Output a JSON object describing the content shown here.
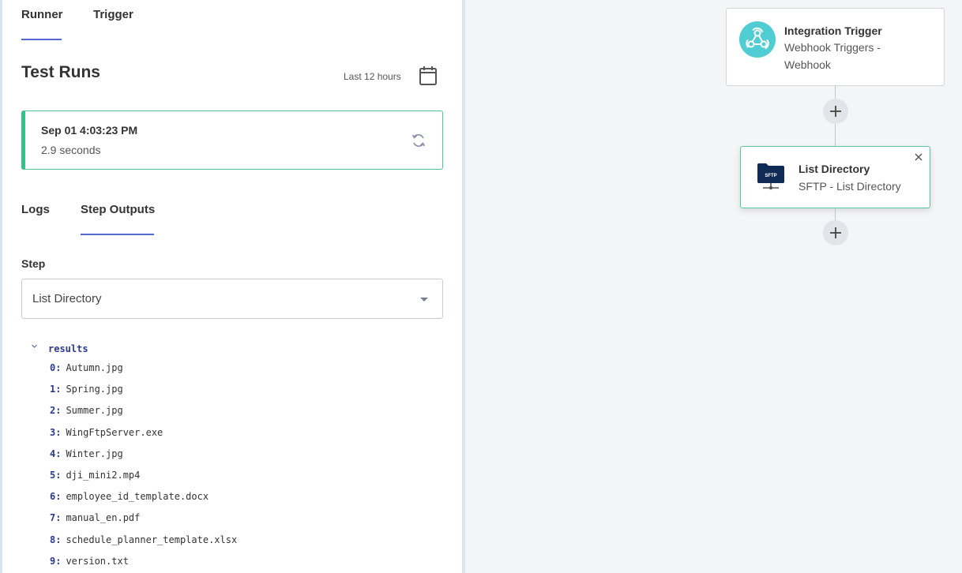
{
  "runner_panel": {
    "tabs": [
      {
        "label": "Runner",
        "active": true
      },
      {
        "label": "Trigger",
        "active": false
      }
    ],
    "title": "Test Runs",
    "time_range": "Last 12 hours",
    "run": {
      "timestamp": "Sep 01 4:03:23 PM",
      "duration": "2.9 seconds"
    },
    "output_tabs": [
      {
        "label": "Logs",
        "active": false
      },
      {
        "label": "Step Outputs",
        "active": true
      }
    ],
    "step_field": {
      "label": "Step",
      "selected": "List Directory"
    },
    "output_tree": {
      "root_key": "results",
      "expanded": true,
      "items": [
        {
          "index": "0:",
          "value": "Autumn.jpg"
        },
        {
          "index": "1:",
          "value": "Spring.jpg"
        },
        {
          "index": "2:",
          "value": "Summer.jpg"
        },
        {
          "index": "3:",
          "value": "WingFtpServer.exe"
        },
        {
          "index": "4:",
          "value": "Winter.jpg"
        },
        {
          "index": "5:",
          "value": "dji_mini2.mp4"
        },
        {
          "index": "6:",
          "value": "employee_id_template.docx"
        },
        {
          "index": "7:",
          "value": "manual_en.pdf"
        },
        {
          "index": "8:",
          "value": "schedule_planner_template.xlsx"
        },
        {
          "index": "9:",
          "value": "version.txt"
        }
      ]
    }
  },
  "canvas": {
    "trigger_node": {
      "icon": "webhook-icon",
      "title": "Integration Trigger",
      "subtitle": "Webhook Triggers - Webhook"
    },
    "step_node": {
      "icon": "sftp-folder-icon",
      "icon_text": "SFTP",
      "title": "List Directory",
      "subtitle": "SFTP - List Directory"
    }
  },
  "colors": {
    "accent": "#5468d4",
    "success": "#2fc48a",
    "webhook": "#4fcdd2",
    "sftp": "#0f2a55"
  }
}
